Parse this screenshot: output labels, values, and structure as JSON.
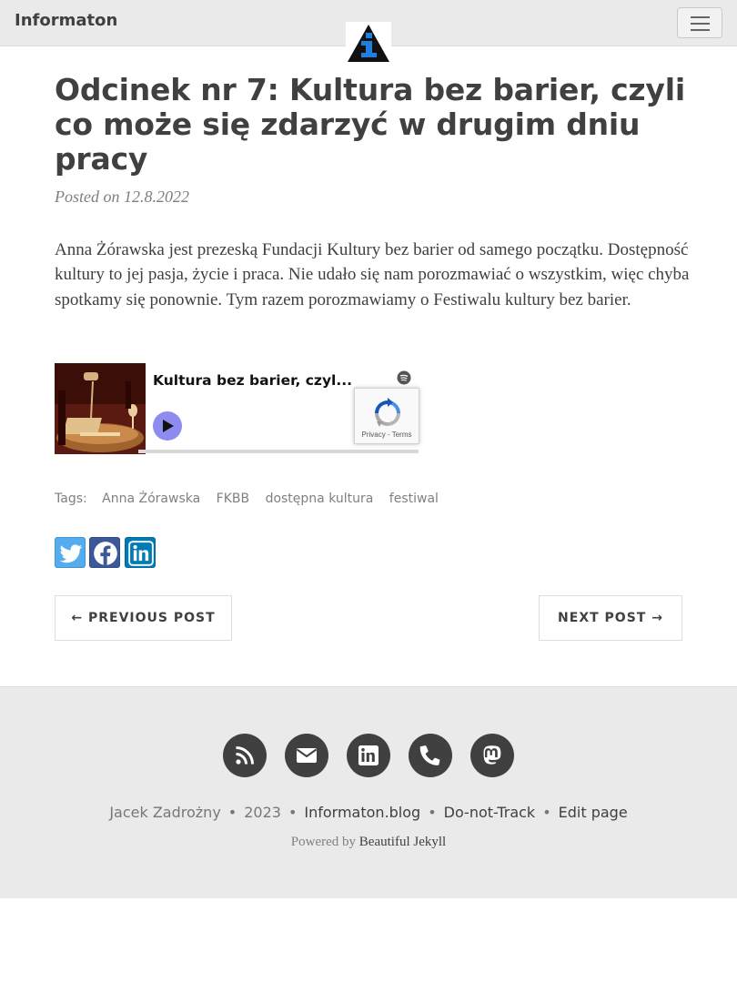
{
  "navbar": {
    "brand": "Informaton",
    "toggle_icon": "hamburger-menu-icon",
    "logo_icon": "info-triangle-logo"
  },
  "post": {
    "title": "Odcinek nr 7: Kultura bez barier, czyli co może się zdarzyć w drugim dniu pracy",
    "meta": "Posted on 12.8.2022",
    "intro": "Anna Żórawska jest prezeską Fundacji Kultury bez barier od samego początku. Dostępność kultury to jej pasja, życie i praca. Nie udało się nam porozmawiać o wszystkim, więc chyba spotkamy się ponownie. Tym razem porozmawiamy o Festiwalu kultury bez barier."
  },
  "embed": {
    "episode_title": "Kultura bez barier, czyl...",
    "recaptcha_links": "Privacy - Terms",
    "play_icon": "play-icon",
    "brand_icon": "spotify-icon",
    "accent": "#8e8cf0"
  },
  "tags": {
    "label": "Tags:",
    "items": [
      "Anna Żórawska",
      "FKBB",
      "dostępna kultura",
      "festiwal"
    ]
  },
  "share": {
    "items": [
      {
        "icon": "twitter-icon",
        "color": "#55acee"
      },
      {
        "icon": "facebook-icon",
        "color": "#3b5998"
      },
      {
        "icon": "linkedin-icon",
        "color": "#007bb5"
      }
    ]
  },
  "pager": {
    "prev": "← Previous Post",
    "next": "Next Post →"
  },
  "footer": {
    "social_icons": [
      "rss-icon",
      "envelope-icon",
      "linkedin-icon",
      "phone-icon",
      "mastodon-icon"
    ],
    "author": "Jacek Zadrożny",
    "year": "2023",
    "blog_link": "Informaton.blog",
    "dnt_link": "Do-not-Track",
    "edit_link": "Edit page",
    "powered_prefix": "Powered by",
    "powered_link": "Beautiful Jekyll"
  }
}
